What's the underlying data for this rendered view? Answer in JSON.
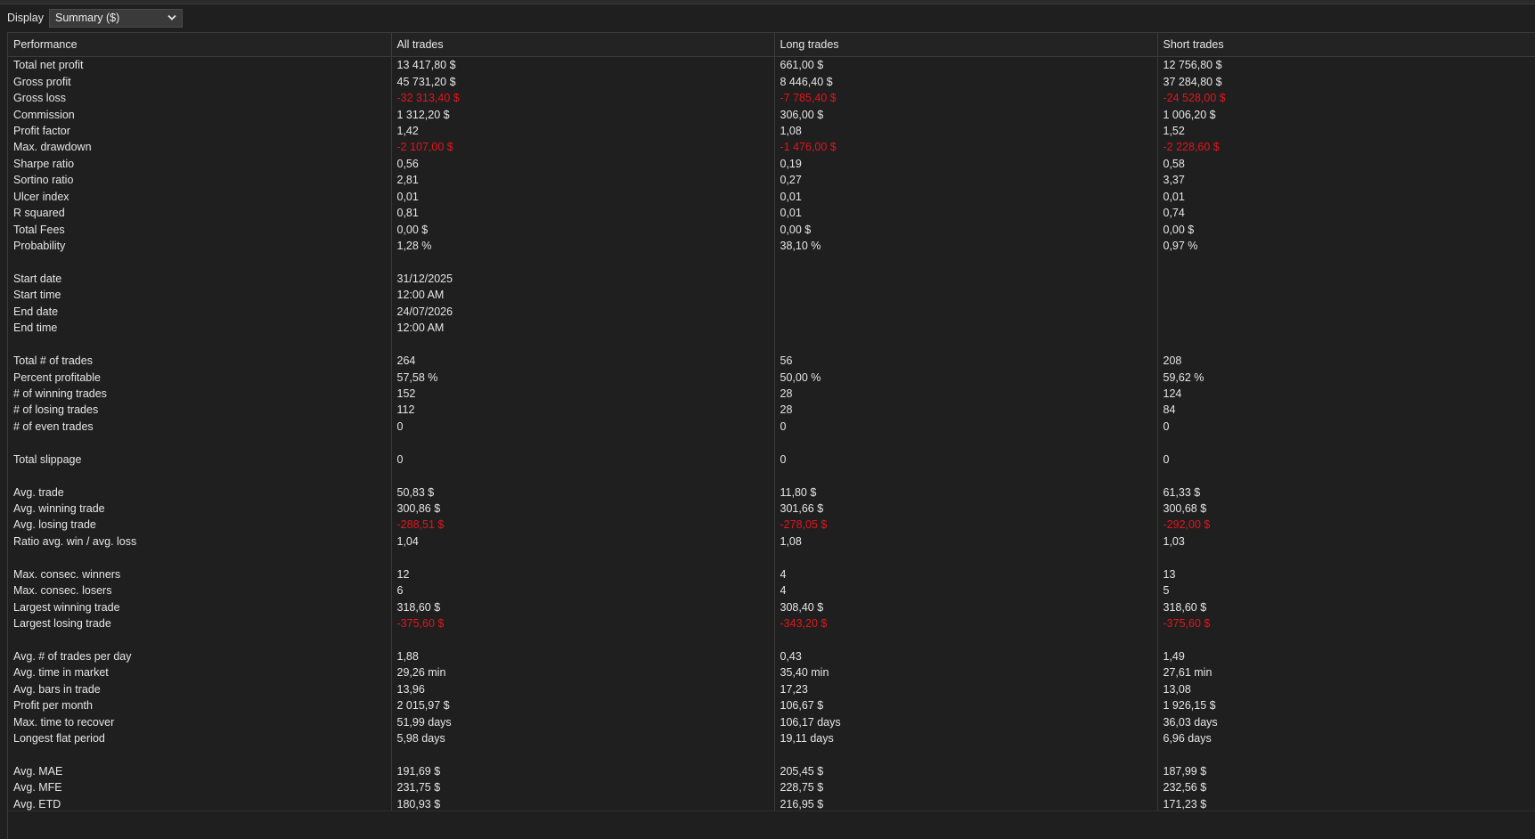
{
  "toolbar": {
    "display_label": "Display",
    "display_value": "Summary ($)"
  },
  "colors": {
    "background": "#1f1f1f",
    "negative": "#e1161c",
    "text": "#e6e6e6",
    "grid": "#3a3a3a"
  },
  "columns": [
    "Performance",
    "All trades",
    "Long trades",
    "Short trades"
  ],
  "rows": [
    {
      "label": "Total net profit",
      "values": [
        "13 417,80 $",
        "661,00 $",
        "12 756,80 $"
      ],
      "negative": false
    },
    {
      "label": "Gross profit",
      "values": [
        "45 731,20 $",
        "8 446,40 $",
        "37 284,80 $"
      ],
      "negative": false
    },
    {
      "label": "Gross loss",
      "values": [
        "-32 313,40 $",
        "-7 785,40 $",
        "-24 528,00 $"
      ],
      "negative": true
    },
    {
      "label": "Commission",
      "values": [
        "1 312,20 $",
        "306,00 $",
        "1 006,20 $"
      ],
      "negative": false
    },
    {
      "label": "Profit factor",
      "values": [
        "1,42",
        "1,08",
        "1,52"
      ],
      "negative": false
    },
    {
      "label": "Max. drawdown",
      "values": [
        "-2 107,00 $",
        "-1 476,00 $",
        "-2 228,60 $"
      ],
      "negative": true
    },
    {
      "label": "Sharpe ratio",
      "values": [
        "0,56",
        "0,19",
        "0,58"
      ],
      "negative": false
    },
    {
      "label": "Sortino ratio",
      "values": [
        "2,81",
        "0,27",
        "3,37"
      ],
      "negative": false
    },
    {
      "label": "Ulcer index",
      "values": [
        "0,01",
        "0,01",
        "0,01"
      ],
      "negative": false
    },
    {
      "label": "R squared",
      "values": [
        "0,81",
        "0,01",
        "0,74"
      ],
      "negative": false
    },
    {
      "label": "Total Fees",
      "values": [
        "0,00 $",
        "0,00 $",
        "0,00 $"
      ],
      "negative": false
    },
    {
      "label": "Probability",
      "values": [
        "1,28 %",
        "38,10 %",
        "0,97 %"
      ],
      "negative": false
    },
    {
      "spacer": true
    },
    {
      "label": "Start date",
      "values": [
        "31/12/2025",
        "",
        ""
      ],
      "negative": false
    },
    {
      "label": "Start time",
      "values": [
        "12:00 AM",
        "",
        ""
      ],
      "negative": false
    },
    {
      "label": "End date",
      "values": [
        "24/07/2026",
        "",
        ""
      ],
      "negative": false
    },
    {
      "label": "End time",
      "values": [
        "12:00 AM",
        "",
        ""
      ],
      "negative": false
    },
    {
      "spacer": true
    },
    {
      "label": "Total # of trades",
      "values": [
        "264",
        "56",
        "208"
      ],
      "negative": false
    },
    {
      "label": "Percent profitable",
      "values": [
        "57,58 %",
        "50,00 %",
        "59,62 %"
      ],
      "negative": false
    },
    {
      "label": "# of winning trades",
      "values": [
        "152",
        "28",
        "124"
      ],
      "negative": false
    },
    {
      "label": "# of losing trades",
      "values": [
        "112",
        "28",
        "84"
      ],
      "negative": false
    },
    {
      "label": "# of even trades",
      "values": [
        "0",
        "0",
        "0"
      ],
      "negative": false
    },
    {
      "spacer": true
    },
    {
      "label": "Total slippage",
      "values": [
        "0",
        "0",
        "0"
      ],
      "negative": false
    },
    {
      "spacer": true
    },
    {
      "label": "Avg. trade",
      "values": [
        "50,83 $",
        "11,80 $",
        "61,33 $"
      ],
      "negative": false
    },
    {
      "label": "Avg. winning trade",
      "values": [
        "300,86 $",
        "301,66 $",
        "300,68 $"
      ],
      "negative": false
    },
    {
      "label": "Avg. losing trade",
      "values": [
        "-288,51 $",
        "-278,05 $",
        "-292,00 $"
      ],
      "negative": true
    },
    {
      "label": "Ratio avg. win / avg. loss",
      "values": [
        "1,04",
        "1,08",
        "1,03"
      ],
      "negative": false
    },
    {
      "spacer": true
    },
    {
      "label": "Max. consec. winners",
      "values": [
        "12",
        "4",
        "13"
      ],
      "negative": false
    },
    {
      "label": "Max. consec. losers",
      "values": [
        "6",
        "4",
        "5"
      ],
      "negative": false
    },
    {
      "label": "Largest winning trade",
      "values": [
        "318,60 $",
        "308,40 $",
        "318,60 $"
      ],
      "negative": false
    },
    {
      "label": "Largest losing trade",
      "values": [
        "-375,60 $",
        "-343,20 $",
        "-375,60 $"
      ],
      "negative": true
    },
    {
      "spacer": true
    },
    {
      "label": "Avg. # of trades per day",
      "values": [
        "1,88",
        "0,43",
        "1,49"
      ],
      "negative": false
    },
    {
      "label": "Avg. time in market",
      "values": [
        "29,26 min",
        "35,40 min",
        "27,61 min"
      ],
      "negative": false
    },
    {
      "label": "Avg. bars in trade",
      "values": [
        "13,96",
        "17,23",
        "13,08"
      ],
      "negative": false
    },
    {
      "label": "Profit per month",
      "values": [
        "2 015,97 $",
        "106,67 $",
        "1 926,15 $"
      ],
      "negative": false
    },
    {
      "label": "Max. time to recover",
      "values": [
        "51,99 days",
        "106,17 days",
        "36,03 days"
      ],
      "negative": false
    },
    {
      "label": "Longest flat period",
      "values": [
        "5,98 days",
        "19,11 days",
        "6,96 days"
      ],
      "negative": false
    },
    {
      "spacer": true
    },
    {
      "label": "Avg. MAE",
      "values": [
        "191,69 $",
        "205,45 $",
        "187,99 $"
      ],
      "negative": false
    },
    {
      "label": "Avg. MFE",
      "values": [
        "231,75 $",
        "228,75 $",
        "232,56 $"
      ],
      "negative": false
    },
    {
      "label": "Avg. ETD",
      "values": [
        "180,93 $",
        "216,95 $",
        "171,23 $"
      ],
      "negative": false
    }
  ]
}
